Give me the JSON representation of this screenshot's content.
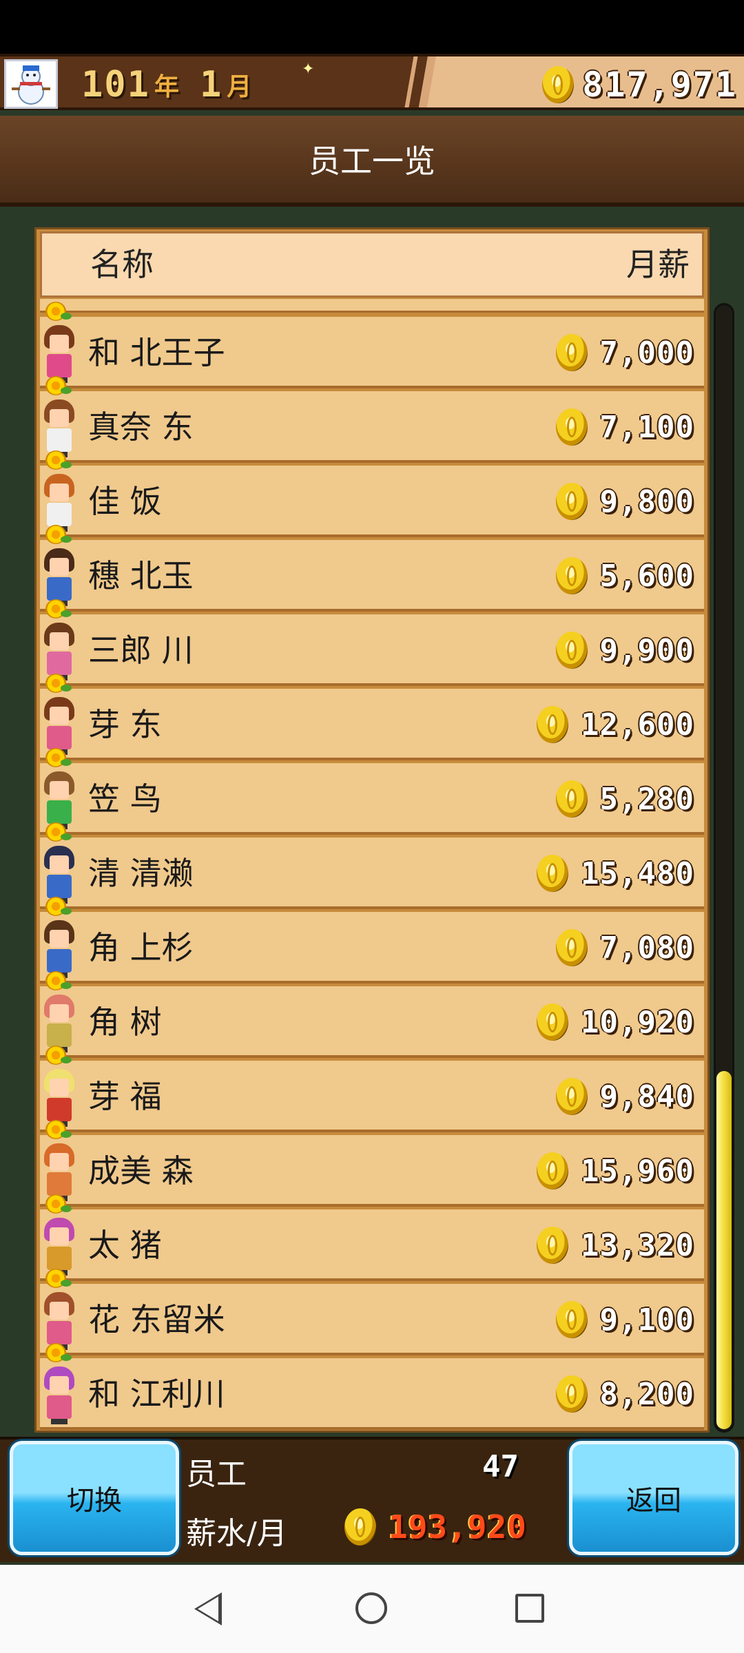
{
  "top_bar": {
    "year": "101",
    "year_unit": "年",
    "month": "1",
    "month_unit": "月",
    "money": "817,971"
  },
  "title": "员工一览",
  "columns": {
    "name": "名称",
    "salary": "月薪"
  },
  "employees": [
    {
      "name": "和 北王子",
      "salary": "7,000",
      "hair": "#7a3a1a",
      "outfit": "#e04a8a"
    },
    {
      "name": "真奈 东",
      "salary": "7,100",
      "hair": "#8a4a22",
      "outfit": "#f0f0f0"
    },
    {
      "name": "佳 饭",
      "salary": "9,800",
      "hair": "#c86420",
      "outfit": "#f0f0f0"
    },
    {
      "name": "穗 北玉",
      "salary": "5,600",
      "hair": "#4a2a18",
      "outfit": "#3a6ac8"
    },
    {
      "name": "三郎 川",
      "salary": "9,900",
      "hair": "#6a3a1a",
      "outfit": "#e06aa0"
    },
    {
      "name": "芽 东",
      "salary": "12,600",
      "hair": "#7a3a1a",
      "outfit": "#e05a8a"
    },
    {
      "name": "笠 鸟",
      "salary": "5,280",
      "hair": "#8a5a2a",
      "outfit": "#3ab04a"
    },
    {
      "name": "清 清濑",
      "salary": "15,480",
      "hair": "#2a3050",
      "outfit": "#3a6ac8"
    },
    {
      "name": "角 上杉",
      "salary": "7,080",
      "hair": "#5a3418",
      "outfit": "#3a6ac8"
    },
    {
      "name": "角 树",
      "salary": "10,920",
      "hair": "#e07a6a",
      "outfit": "#c8b04a"
    },
    {
      "name": "芽 福",
      "salary": "9,840",
      "hair": "#f0e070",
      "outfit": "#d03a2a"
    },
    {
      "name": "成美 森",
      "salary": "15,960",
      "hair": "#d86a2a",
      "outfit": "#e07a3a"
    },
    {
      "name": "太 猪",
      "salary": "13,320",
      "hair": "#c04ab0",
      "outfit": "#d89a2a"
    },
    {
      "name": "花 东留米",
      "salary": "9,100",
      "hair": "#a0502a",
      "outfit": "#e05a8a"
    },
    {
      "name": "和 江利川",
      "salary": "8,200",
      "hair": "#b04ac0",
      "outfit": "#e05a8a"
    }
  ],
  "footer": {
    "switch_label": "切换",
    "back_label": "返回",
    "staff_label": "员工",
    "staff_count": "47",
    "wage_label": "薪水/月",
    "wage_total": "193,920"
  },
  "scrollbar": {
    "position_fraction": 0.73,
    "visible_fraction": 0.32
  }
}
